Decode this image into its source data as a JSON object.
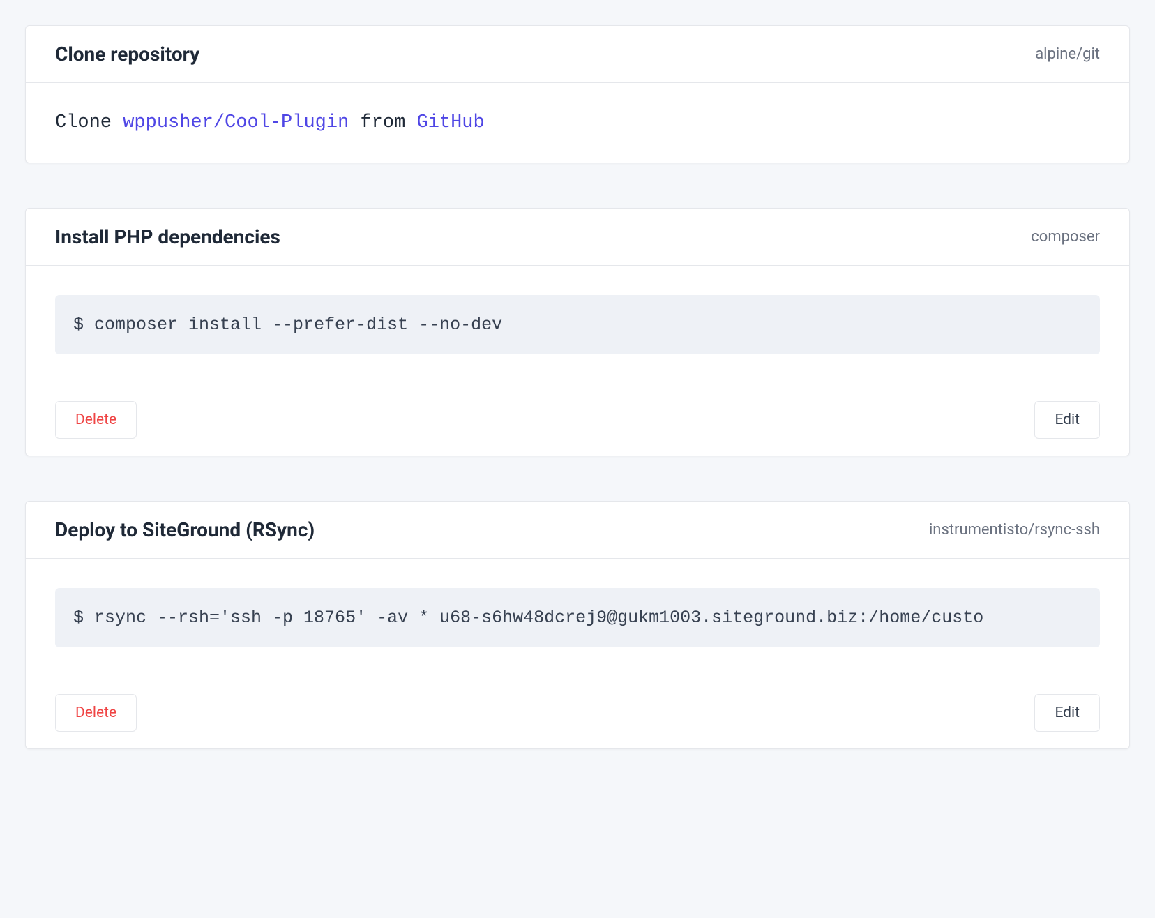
{
  "cards": [
    {
      "title": "Clone repository",
      "tag": "alpine/git",
      "clone": {
        "prefix": "Clone ",
        "repo": "wppusher/Cool-Plugin",
        "middle": " from ",
        "source": "GitHub"
      }
    },
    {
      "title": "Install PHP dependencies",
      "tag": "composer",
      "command": "$ composer install --prefer-dist --no-dev",
      "delete_label": "Delete",
      "edit_label": "Edit"
    },
    {
      "title": "Deploy to SiteGround (RSync)",
      "tag": "instrumentisto/rsync-ssh",
      "command": "$ rsync --rsh='ssh -p 18765' -av * u68-s6hw48dcrej9@gukm1003.siteground.biz:/home/custo",
      "delete_label": "Delete",
      "edit_label": "Edit"
    }
  ]
}
